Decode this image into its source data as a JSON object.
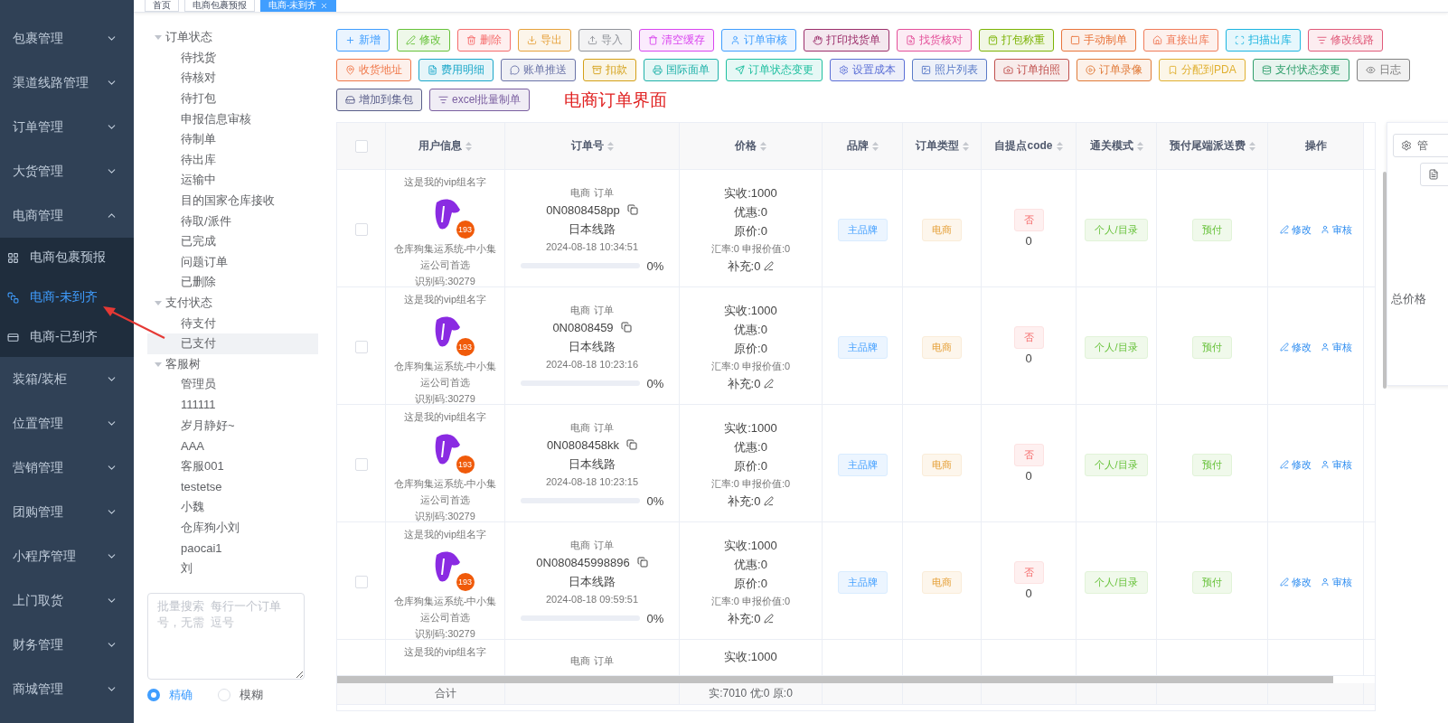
{
  "top_tabs": [
    {
      "label": "首页",
      "selected": false
    },
    {
      "label": "电商包裹预报",
      "selected": false
    },
    {
      "label": "电商-未到齐",
      "selected": true
    }
  ],
  "sidebar": {
    "items": [
      {
        "label": "包裹管理",
        "expanded": false
      },
      {
        "label": "渠道线路管理",
        "expanded": false
      },
      {
        "label": "订单管理",
        "expanded": false
      },
      {
        "label": "大货管理",
        "expanded": false
      },
      {
        "label": "电商管理",
        "expanded": true,
        "children": [
          {
            "label": "电商包裹预报",
            "selected": false
          },
          {
            "label": "电商-未到齐",
            "selected": true
          },
          {
            "label": "电商-已到齐",
            "selected": false
          }
        ]
      },
      {
        "label": "装箱/装柜",
        "expanded": false
      },
      {
        "label": "位置管理",
        "expanded": false
      },
      {
        "label": "营销管理",
        "expanded": false
      },
      {
        "label": "团购管理",
        "expanded": false
      },
      {
        "label": "小程序管理",
        "expanded": false
      },
      {
        "label": "上门取货",
        "expanded": false
      },
      {
        "label": "财务管理",
        "expanded": false
      },
      {
        "label": "商城管理",
        "expanded": false
      }
    ]
  },
  "tree": [
    {
      "label": "订单状态",
      "expanded": true,
      "children": [
        {
          "label": "待找货",
          "selected": false
        },
        {
          "label": "待核对",
          "selected": false
        },
        {
          "label": "待打包",
          "selected": false
        },
        {
          "label": "申报信息审核",
          "selected": false
        },
        {
          "label": "待制单",
          "selected": false
        },
        {
          "label": "待出库",
          "selected": false
        },
        {
          "label": "运输中",
          "selected": false
        },
        {
          "label": "目的国家仓库接收",
          "selected": false
        },
        {
          "label": "待取/派件",
          "selected": false
        },
        {
          "label": "已完成",
          "selected": false
        },
        {
          "label": "问题订单",
          "selected": false
        },
        {
          "label": "已删除",
          "selected": false
        }
      ]
    },
    {
      "label": "支付状态",
      "expanded": true,
      "children": [
        {
          "label": "待支付",
          "selected": false
        },
        {
          "label": "已支付",
          "selected": true
        }
      ]
    },
    {
      "label": "客服树",
      "expanded": true,
      "children": [
        {
          "label": "管理员",
          "selected": false
        },
        {
          "label": "111111",
          "selected": false
        },
        {
          "label": "岁月静好~",
          "selected": false
        },
        {
          "label": "AAA",
          "selected": false
        },
        {
          "label": "客服001",
          "selected": false
        },
        {
          "label": "testetse",
          "selected": false
        },
        {
          "label": "小魏",
          "selected": false
        },
        {
          "label": "仓库狗小刘",
          "selected": false
        },
        {
          "label": "paocai1",
          "selected": false
        },
        {
          "label": "刘",
          "selected": false
        }
      ]
    }
  ],
  "batch_search": {
    "placeholder": "批量搜索  每行一个订单号，无需  逗号"
  },
  "match_mode": [
    {
      "label": "精确",
      "selected": true
    },
    {
      "label": "模糊",
      "selected": false
    }
  ],
  "toolbar_rows": [
    [
      {
        "label": "新增",
        "color": "#409eff"
      },
      {
        "label": "修改",
        "color": "#67c23a"
      },
      {
        "label": "删除",
        "color": "#f56c6c"
      },
      {
        "label": "导出",
        "color": "#e6a23c"
      },
      {
        "label": "导入",
        "color": "#909399"
      },
      {
        "label": "清空缓存",
        "color": "#d946ef"
      },
      {
        "label": "订单审核",
        "color": "#409eff"
      },
      {
        "label": "打印找货单",
        "color": "#9c2f6b"
      },
      {
        "label": "找货核对",
        "color": "#e4509a"
      },
      {
        "label": "打包称重",
        "color": "#7cb305"
      },
      {
        "label": "手动制单",
        "color": "#e8743b"
      },
      {
        "label": "直接出库",
        "color": "#f07c5a"
      },
      {
        "label": "扫描出库",
        "color": "#1cb5e0"
      },
      {
        "label": "修改线路",
        "color": "#e05a7a"
      }
    ],
    [
      {
        "label": "收货地址",
        "color": "#f0784a"
      },
      {
        "label": "费用明细",
        "color": "#1aa7c9"
      },
      {
        "label": "账单推送",
        "color": "#6b74a8"
      },
      {
        "label": "扣款",
        "color": "#d4a017"
      },
      {
        "label": "国际面单",
        "color": "#20b2aa"
      },
      {
        "label": "订单状态变更",
        "color": "#1fbfa0"
      },
      {
        "label": "设置成本",
        "color": "#5b6fd6"
      },
      {
        "label": "照片列表",
        "color": "#5a7bc8"
      },
      {
        "label": "订单拍照",
        "color": "#c0504d"
      },
      {
        "label": "订单录像",
        "color": "#e07b39"
      },
      {
        "label": "分配到PDA",
        "color": "#e0b030"
      },
      {
        "label": "支付状态变更",
        "color": "#2e9e6b"
      },
      {
        "label": "日志",
        "color": "#808080"
      }
    ],
    [
      {
        "label": "增加到集包",
        "color": "#5a5e8a"
      },
      {
        "label": "excel批量制单",
        "color": "#7a5ea0"
      }
    ]
  ],
  "page_heading": "电商订单界面",
  "table": {
    "header_checked": false,
    "columns": [
      {
        "label": "用户信息",
        "sortable": true
      },
      {
        "label": "订单号",
        "sortable": true
      },
      {
        "label": "价格",
        "sortable": true
      },
      {
        "label": "品牌",
        "sortable": true
      },
      {
        "label": "订单类型",
        "sortable": true
      },
      {
        "label": "自提点code",
        "sortable": true
      },
      {
        "label": "通关模式",
        "sortable": true
      },
      {
        "label": "预付尾端派送费",
        "sortable": true
      },
      {
        "label": "操作",
        "sortable": false
      }
    ],
    "rows": [
      {
        "checked": false,
        "vip_group": "这是我的vip组名字",
        "badge": "193",
        "company": "仓库狗集运系统-中小集运公司首选",
        "id_code": "识别码:30279",
        "order_kind": "电商 订单",
        "order_no": "0N0808458pp",
        "route": "日本线路",
        "time": "2024-08-18 10:34:51",
        "progress": {
          "level": 0,
          "reading": "0%"
        },
        "received": "实收:1000",
        "discount": "优惠:0",
        "original": "原价:0",
        "rate_line": "汇率:0 申报价值:0",
        "extra": "补充:0",
        "brand": "主品牌",
        "order_type": "电商",
        "pickup_tag": "否",
        "pickup_code": "0",
        "clearance": "个人/目录",
        "fee": "预付",
        "actions": [
          "修改",
          "审核"
        ]
      },
      {
        "checked": false,
        "vip_group": "这是我的vip组名字",
        "badge": "193",
        "company": "仓库狗集运系统-中小集运公司首选",
        "id_code": "识别码:30279",
        "order_kind": "电商 订单",
        "order_no": "0N0808459",
        "route": "日本线路",
        "time": "2024-08-18 10:23:16",
        "progress": {
          "level": 0,
          "reading": "0%"
        },
        "received": "实收:1000",
        "discount": "优惠:0",
        "original": "原价:0",
        "rate_line": "汇率:0 申报价值:0",
        "extra": "补充:0",
        "brand": "主品牌",
        "order_type": "电商",
        "pickup_tag": "否",
        "pickup_code": "0",
        "clearance": "个人/目录",
        "fee": "预付",
        "actions": [
          "修改",
          "审核"
        ]
      },
      {
        "checked": false,
        "vip_group": "这是我的vip组名字",
        "badge": "193",
        "company": "仓库狗集运系统-中小集运公司首选",
        "id_code": "识别码:30279",
        "order_kind": "电商 订单",
        "order_no": "0N0808458kk",
        "route": "日本线路",
        "time": "2024-08-18 10:23:15",
        "progress": {
          "level": 0,
          "reading": "0%"
        },
        "received": "实收:1000",
        "discount": "优惠:0",
        "original": "原价:0",
        "rate_line": "汇率:0 申报价值:0",
        "extra": "补充:0",
        "brand": "主品牌",
        "order_type": "电商",
        "pickup_tag": "否",
        "pickup_code": "0",
        "clearance": "个人/目录",
        "fee": "预付",
        "actions": [
          "修改",
          "审核"
        ]
      },
      {
        "checked": false,
        "vip_group": "这是我的vip组名字",
        "badge": "193",
        "company": "仓库狗集运系统-中小集运公司首选",
        "id_code": "识别码:30279",
        "order_kind": "电商 订单",
        "order_no": "0N080845998896",
        "route": "日本线路",
        "time": "2024-08-18 09:59:51",
        "progress": {
          "level": 0,
          "reading": "0%"
        },
        "received": "实收:1000",
        "discount": "优惠:0",
        "original": "原价:0",
        "rate_line": "汇率:0 申报价值:0",
        "extra": "补充:0",
        "brand": "主品牌",
        "order_type": "电商",
        "pickup_tag": "否",
        "pickup_code": "0",
        "clearance": "个人/目录",
        "fee": "预付",
        "actions": [
          "修改",
          "审核"
        ]
      },
      {
        "vip_group": "这是我的vip组名字",
        "order_kind": "电商 订单",
        "received": "实收:1000"
      }
    ],
    "footer": {
      "label": "合计",
      "price_total": "实:7010 优:0 原:0"
    }
  },
  "side_panel": {
    "button": "管",
    "label": "总价格"
  }
}
